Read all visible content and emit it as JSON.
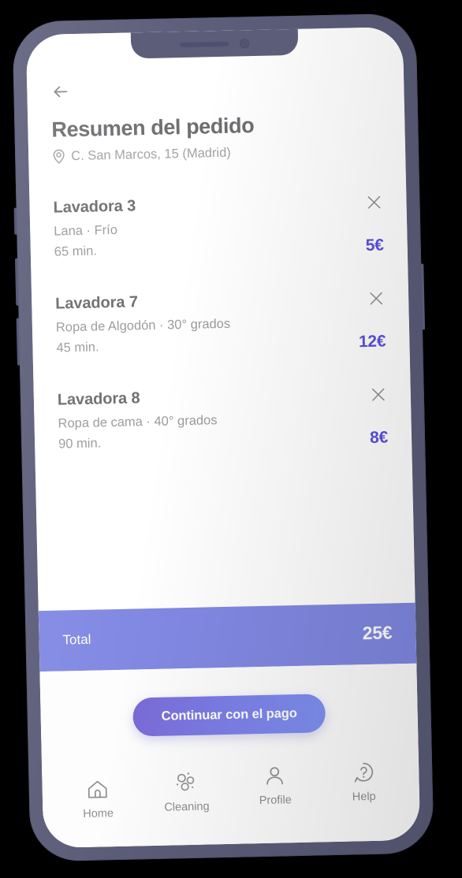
{
  "device": {
    "frame_color": "#5b5d79",
    "screen_background": "#ffffff"
  },
  "screen": {
    "back_button": "back-arrow-icon",
    "title": "Resumen del pedido",
    "address": {
      "icon": "location-pin-icon",
      "text": "C. San Marcos, 15 (Madrid)"
    }
  },
  "order": {
    "items": [
      {
        "name": "Lavadora 3",
        "description": "Lana · Frío",
        "duration": "65 min.",
        "price": "5€",
        "remove_icon": "close-icon"
      },
      {
        "name": "Lavadora 7",
        "description": "Ropa de Algodón · 30° grados",
        "duration": "45 min.",
        "price": "12€",
        "remove_icon": "close-icon"
      },
      {
        "name": "Lavadora 8",
        "description": "Ropa de cama · 40° grados",
        "duration": "90 min.",
        "price": "8€",
        "remove_icon": "close-icon"
      }
    ],
    "total_label": "Total",
    "total_value": "25€"
  },
  "cta": {
    "label": "Continuar con el pago"
  },
  "tabbar": {
    "items": [
      {
        "label": "Home",
        "icon": "home-icon"
      },
      {
        "label": "Cleaning",
        "icon": "bubbles-icon"
      },
      {
        "label": "Profile",
        "icon": "person-icon"
      },
      {
        "label": "Help",
        "icon": "question-bubble-icon"
      }
    ]
  },
  "colors": {
    "price_purple": "#5b4fe0",
    "total_bar": "#8189e3",
    "cta_gradient_start": "#7a6ad6",
    "cta_gradient_end": "#7f92f3",
    "title_gray": "#6e6e72",
    "muted_gray": "#9b9b9f"
  }
}
